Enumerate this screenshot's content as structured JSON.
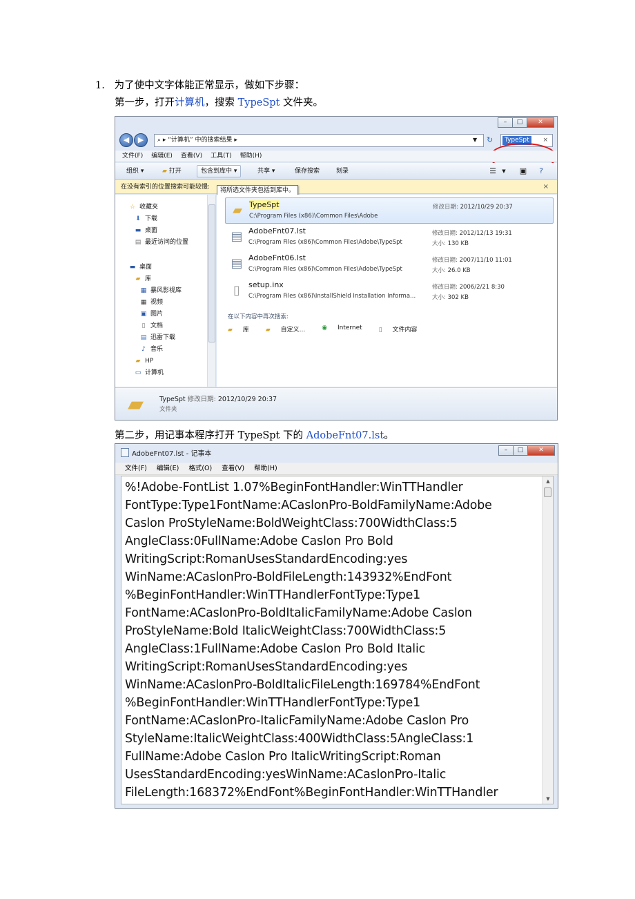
{
  "step_heading": {
    "number": "1.",
    "text": "为了使中文字体能正常显示，做如下步骤："
  },
  "step1": {
    "pre": "第一步，打开",
    "link1": "计算机",
    "mid": "，搜索 ",
    "link2": "TypeSpt",
    "post": " 文件夹。"
  },
  "step2": {
    "pre": "第二步，用记事本程序打开 TypeSpt 下的 ",
    "link": "AdobeFnt07.lst",
    "post": "。"
  },
  "explorer": {
    "address": "“计算机” 中的搜索结果",
    "search_value": "TypeSpt",
    "menu": [
      "文件(F)",
      "编辑(E)",
      "查看(V)",
      "工具(T)",
      "帮助(H)"
    ],
    "toolbar": {
      "organize": "组织 ▾",
      "open": "打开",
      "include": "包含到库中 ▾",
      "share": "共享 ▾",
      "save_search": "保存搜索",
      "burn": "刻录"
    },
    "infobar": "在没有索引的位置搜索可能较慢:",
    "tooltip": "将所选文件夹包括到库中。",
    "nav": {
      "favorites": "收藏夹",
      "downloads": "下载",
      "desktop_fav": "桌面",
      "recent": "最近访问的位置",
      "desktop": "桌面",
      "library": "库",
      "storm": "暴风影视库",
      "video": "视频",
      "pictures": "图片",
      "docs": "文档",
      "xunlei": "迅雷下载",
      "music": "音乐",
      "hp": "HP",
      "computer": "计算机"
    },
    "results": [
      {
        "name": "TypeSpt",
        "path": "C:\\Program Files (x86)\\Common Files\\Adobe",
        "date_label": "修改日期:",
        "date": "2012/10/29 20:37",
        "size_label": "",
        "size": ""
      },
      {
        "name": "AdobeFnt07.lst",
        "path": "C:\\Program Files (x86)\\Common Files\\Adobe\\TypeSpt",
        "date_label": "修改日期:",
        "date": "2012/12/13 19:31",
        "size_label": "大小:",
        "size": "130 KB"
      },
      {
        "name": "AdobeFnt06.lst",
        "path": "C:\\Program Files (x86)\\Common Files\\Adobe\\TypeSpt",
        "date_label": "修改日期:",
        "date": "2007/11/10 11:01",
        "size_label": "大小:",
        "size": "26.0 KB"
      },
      {
        "name": "setup.inx",
        "path": "C:\\Program Files (x86)\\InstallShield Installation Informa...",
        "date_label": "修改日期:",
        "date": "2006/2/21 8:30",
        "size_label": "大小:",
        "size": "302 KB"
      }
    ],
    "search_again_label": "在以下内容中再次搜索:",
    "search_again": [
      "库",
      "自定义...",
      "Internet",
      "文件内容"
    ],
    "details": {
      "name": "TypeSpt",
      "date_label": "修改日期:",
      "date": "2012/10/29 20:37",
      "type": "文件夹"
    }
  },
  "notepad": {
    "title": "AdobeFnt07.lst - 记事本",
    "menu": [
      "文件(F)",
      "编辑(E)",
      "格式(O)",
      "查看(V)",
      "帮助(H)"
    ],
    "lines": [
      "%!Adobe-FontList 1.07%BeginFontHandler:WinTTHandler",
      "FontType:Type1FontName:ACaslonPro-BoldFamilyName:Adobe",
      "Caslon ProStyleName:BoldWeightClass:700WidthClass:5",
      "AngleClass:0FullName:Adobe Caslon Pro Bold",
      "WritingScript:RomanUsesStandardEncoding:yes",
      "WinName:ACaslonPro-BoldFileLength:143932%EndFont",
      "%BeginFontHandler:WinTTHandlerFontType:Type1",
      "FontName:ACaslonPro-BoldItalicFamilyName:Adobe Caslon",
      "ProStyleName:Bold ItalicWeightClass:700WidthClass:5",
      "AngleClass:1FullName:Adobe Caslon Pro Bold Italic",
      "WritingScript:RomanUsesStandardEncoding:yes",
      "WinName:ACaslonPro-BoldItalicFileLength:169784%EndFont",
      "%BeginFontHandler:WinTTHandlerFontType:Type1",
      "FontName:ACaslonPro-ItalicFamilyName:Adobe Caslon Pro",
      "StyleName:ItalicWeightClass:400WidthClass:5AngleClass:1",
      "FullName:Adobe Caslon Pro ItalicWritingScript:Roman",
      "UsesStandardEncoding:yesWinName:ACaslonPro-Italic",
      "FileLength:168372%EndFont%BeginFontHandler:WinTTHandler"
    ]
  }
}
